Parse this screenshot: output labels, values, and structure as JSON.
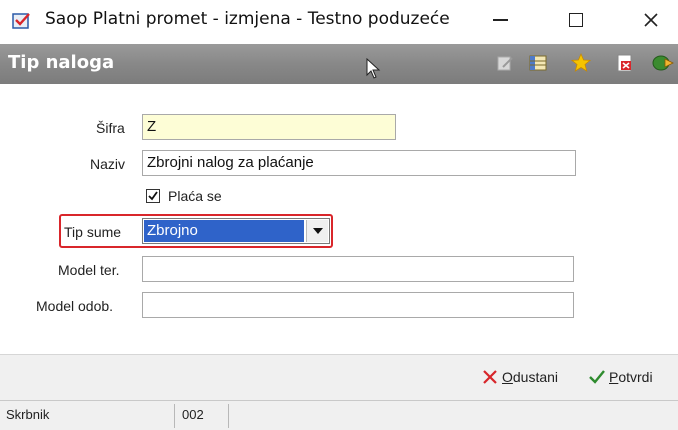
{
  "window": {
    "title": "Saop Platni promet - izmjena - Testno poduzeće",
    "controls": {
      "minimize": "—",
      "maximize": "☐",
      "close": "✕"
    }
  },
  "header": {
    "title": "Tip naloga",
    "tools": [
      "edit-note-icon",
      "columns-icon",
      "favorite-star-icon",
      "delete-doc-icon",
      "export-icon"
    ]
  },
  "form": {
    "sifra": {
      "label": "Šifra",
      "value": "Z"
    },
    "naziv": {
      "label": "Naziv",
      "value": "Zbrojni nalog za plaćanje"
    },
    "placa_se": {
      "label": "Plaća se",
      "checked": true
    },
    "tip_sume": {
      "label": "Tip sume",
      "value": "Zbrojno"
    },
    "model_ter": {
      "label": "Model ter.",
      "value": ""
    },
    "model_odob": {
      "label": "Model odob.",
      "value": ""
    }
  },
  "actions": {
    "cancel": "Odustani",
    "confirm": "Potvrdi"
  },
  "status": {
    "user": "Skrbnik",
    "code": "002"
  },
  "colors": {
    "header_bg": "#888888",
    "highlight_border": "#d9262b",
    "selection_bg": "#2f63c9",
    "required_field_bg": "#fdfdd6",
    "cancel_icon": "#d7262b",
    "confirm_icon": "#2e8b2e"
  }
}
